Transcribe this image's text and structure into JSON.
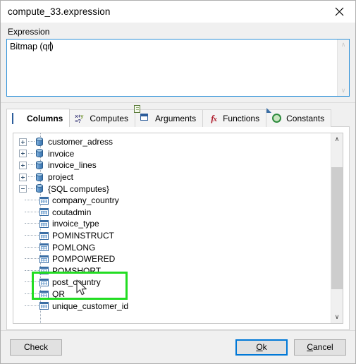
{
  "window": {
    "title": "compute_33.expression",
    "close_label": "✕"
  },
  "expression": {
    "label": "Expression",
    "value_before_caret": "Bitmap (qr",
    "value_after_caret": ")",
    "full_value": "Bitmap (qr)",
    "placeholder": ""
  },
  "tabs": [
    {
      "label": "Columns",
      "icon": "table-icon",
      "active": true
    },
    {
      "label": "Computes",
      "icon": "formula-icon",
      "active": false
    },
    {
      "label": "Arguments",
      "icon": "arguments-icon",
      "active": false
    },
    {
      "label": "Functions",
      "icon": "fx-icon",
      "active": false
    },
    {
      "label": "Constants",
      "icon": "constants-icon",
      "active": false
    }
  ],
  "tree": {
    "nodes": [
      {
        "label": "customer_adress",
        "level": 0,
        "icon": "database-icon",
        "expanded": false
      },
      {
        "label": "invoice",
        "level": 0,
        "icon": "database-icon",
        "expanded": false
      },
      {
        "label": "invoice_lines",
        "level": 0,
        "icon": "database-icon",
        "expanded": false
      },
      {
        "label": "project",
        "level": 0,
        "icon": "database-icon",
        "expanded": false
      },
      {
        "label": "{SQL computes}",
        "level": 0,
        "icon": "database-icon",
        "expanded": true
      },
      {
        "label": "company_country",
        "level": 1,
        "icon": "grid-icon"
      },
      {
        "label": "coutadmin",
        "level": 1,
        "icon": "grid-icon"
      },
      {
        "label": "invoice_type",
        "level": 1,
        "icon": "grid-icon"
      },
      {
        "label": "POMINSTRUCT",
        "level": 1,
        "icon": "grid-icon"
      },
      {
        "label": "POMLONG",
        "level": 1,
        "icon": "grid-icon"
      },
      {
        "label": "POMPOWERED",
        "level": 1,
        "icon": "grid-icon"
      },
      {
        "label": "POMSHORT",
        "level": 1,
        "icon": "grid-icon"
      },
      {
        "label": "post_country",
        "level": 1,
        "icon": "grid-icon"
      },
      {
        "label": "QR",
        "level": 1,
        "icon": "grid-icon"
      },
      {
        "label": "unique_customer_id",
        "level": 1,
        "icon": "grid-icon"
      }
    ],
    "scrollbar": {
      "up": "∧",
      "down": "∨"
    }
  },
  "footer": {
    "check_label": "Check",
    "ok_label_underlined": "O",
    "ok_label_rest": "k",
    "cancel_label_underlined": "C",
    "cancel_label_rest": "ancel"
  },
  "colors": {
    "accent_focus": "#0078d7",
    "annotation": "#22dd22",
    "dialog_bg": "#f0f0f0",
    "panel_bg": "#ffffff"
  }
}
